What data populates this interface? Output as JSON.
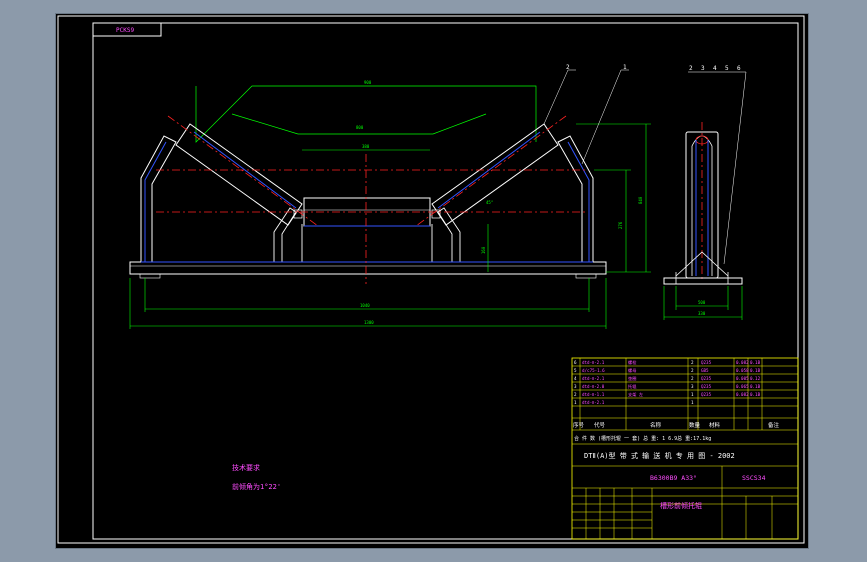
{
  "drawing_number_top": "PCKS9",
  "dimensions": {
    "top_width": "900",
    "mid_span": "800",
    "center_roller": "380",
    "total_height": "840",
    "side_height": "276",
    "base_height": "160",
    "inner_width": "1040",
    "total_width": "1300",
    "side_base": "500",
    "side_total": "330",
    "angle": "45°"
  },
  "part_callouts_front": [
    "2",
    "1"
  ],
  "part_callouts_side": [
    "2",
    "3",
    "4",
    "5",
    "6"
  ],
  "notes": {
    "title": "技术要求",
    "line1": "前倾角为1°22'"
  },
  "bom": {
    "rows": [
      {
        "no": "6",
        "code": "dtd-Ⅱ-2.1",
        "name": "螺栓",
        "qty": "2",
        "material": "Q235",
        "mass1": "0.082",
        "mass2": "0.1B"
      },
      {
        "no": "5",
        "code": "d/c75-1.6",
        "name": "螺母",
        "qty": "2",
        "material": "GB5",
        "mass1": "0.058",
        "mass2": "0.1B"
      },
      {
        "no": "4",
        "code": "dtd-Ⅱ-2.1",
        "name": "垫圈",
        "qty": "2",
        "material": "Q235",
        "mass1": "0.005",
        "mass2": "0.12"
      },
      {
        "no": "3",
        "code": "dtd-Ⅱ-2.0",
        "name": "托辊",
        "qty": "3",
        "material": "Q235",
        "mass1": "0.065",
        "mass2": "0.1B"
      },
      {
        "no": "2",
        "code": "dtd-Ⅱ-1.1",
        "name": "支架 左",
        "qty": "1",
        "material": "Q235",
        "mass1": "0.082",
        "mass2": "0.1B"
      },
      {
        "no": "1",
        "code": "dtd-Ⅱ-2.1",
        "name": "",
        "qty": "1",
        "material": "",
        "mass1": "",
        "mass2": ""
      }
    ],
    "header": {
      "no": "序号",
      "code": "代号",
      "name": "名称",
      "qty": "数量",
      "material": "材料",
      "remark": "备注"
    },
    "summary": "合  件  数  (槽形托辊  一  套)  总  重:  1  6.9总  重:17.1kg",
    "series_title": "DTⅡ(A)型  带  式  输  送  机  专  用  图  -  2002",
    "drawing_code": "B6300B9  A33°",
    "sheet_code": "SSCS34",
    "drawing_title": "槽形前倾托辊"
  }
}
